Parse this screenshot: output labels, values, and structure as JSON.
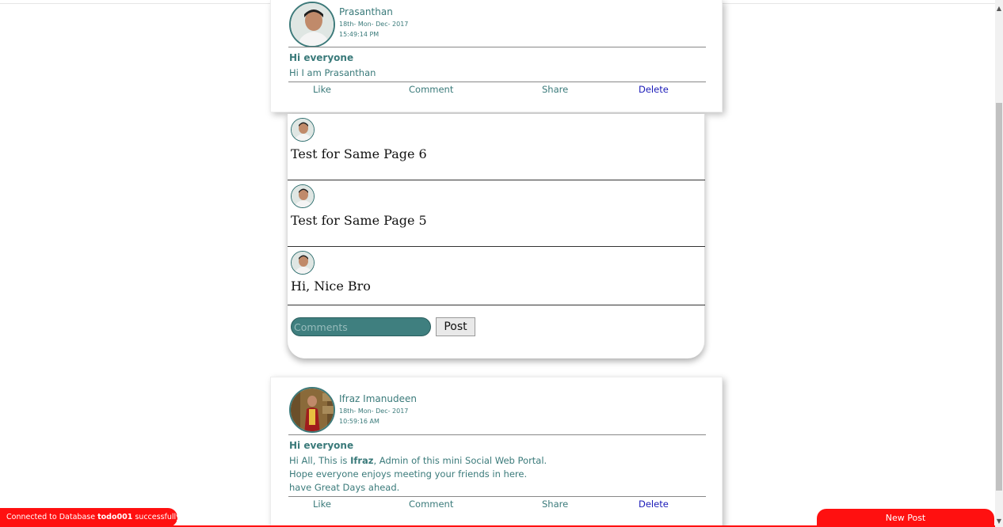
{
  "posts": [
    {
      "author": "Prasanthan",
      "date_line1": "18th- Mon- Dec- 2017",
      "date_line2": "15:49:14 PM",
      "title": "Hi everyone",
      "body_lines": [
        "Hi I am Prasanthan"
      ],
      "actions": {
        "like": "Like",
        "comment": "Comment",
        "share": "Share",
        "delete": "Delete"
      }
    },
    {
      "author": "Ifraz Imanudeen",
      "date_line1": "18th- Mon- Dec- 2017",
      "date_line2": "10:59:16 AM",
      "title": "Hi everyone",
      "body_line1_pre": "Hi All, This is ",
      "body_line1_bold": "Ifraz",
      "body_line1_post": ", Admin of this mini Social Web Portal.",
      "body_lines": [
        "Hope everyone enjoys meeting your friends in here.",
        "have Great Days ahead."
      ],
      "actions": {
        "like": "Like",
        "comment": "Comment",
        "share": "Share",
        "delete": "Delete"
      }
    }
  ],
  "comments": {
    "items": [
      {
        "text": "Test for Same Page 6"
      },
      {
        "text": "Test for Same Page 5"
      },
      {
        "text": "Hi, Nice Bro"
      }
    ],
    "input_placeholder": "Comments",
    "post_label": "Post"
  },
  "status": {
    "prefix": "Connected to Database ",
    "db_name": "todo001",
    "suffix": " successfully"
  },
  "new_post_label": "New Post",
  "colors": {
    "accent_teal": "#3a7a7a",
    "delete_blue": "#1a1ab8",
    "alert_red": "#ff1010"
  }
}
